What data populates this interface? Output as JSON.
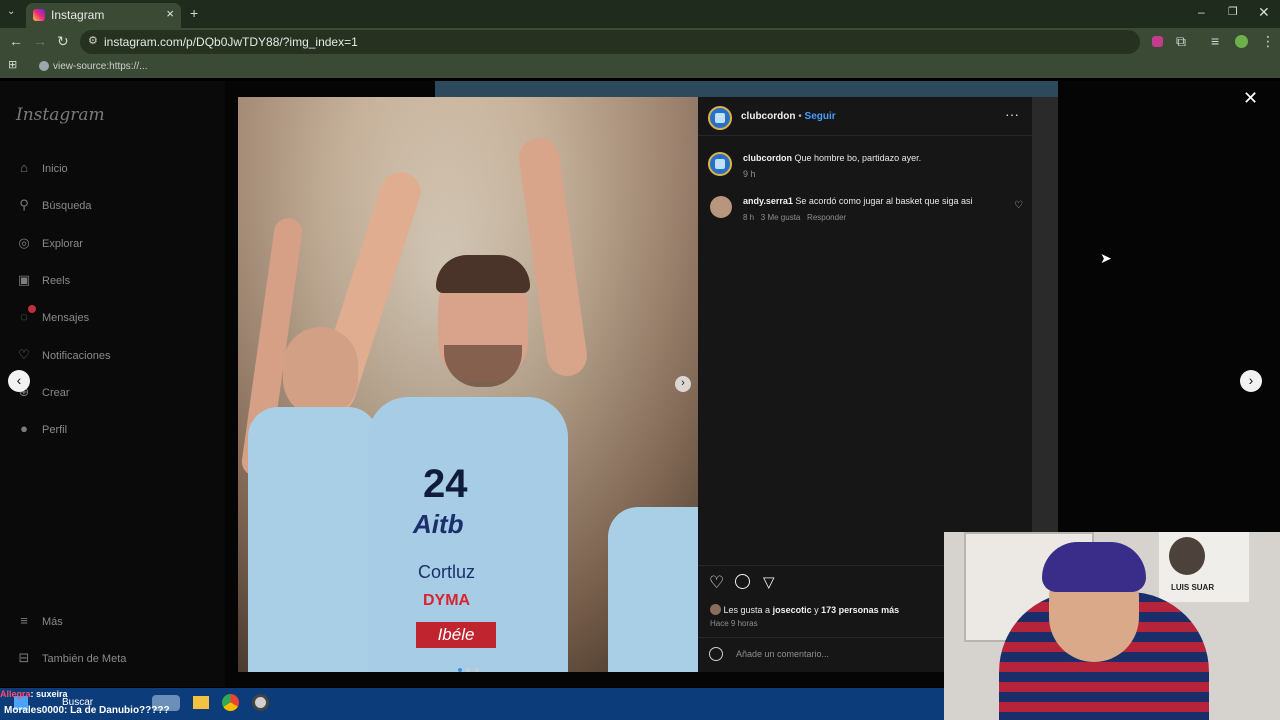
{
  "browser": {
    "tab_title": "Instagram",
    "url": "instagram.com/p/DQb0JwTDY88/?img_index=1",
    "bookmark": "view-source:https://..."
  },
  "instagram": {
    "logo": "Instagram",
    "nav": [
      {
        "label": "Inicio",
        "icon": "home-icon"
      },
      {
        "label": "Búsqueda",
        "icon": "search-icon"
      },
      {
        "label": "Explorar",
        "icon": "compass-icon"
      },
      {
        "label": "Reels",
        "icon": "reels-icon"
      },
      {
        "label": "Mensajes",
        "icon": "messenger-icon"
      },
      {
        "label": "Notificaciones",
        "icon": "heart-icon"
      },
      {
        "label": "Crear",
        "icon": "plus-icon"
      },
      {
        "label": "Perfil",
        "icon": "profile-avatar"
      }
    ],
    "more": "Más",
    "meta": "También de Meta"
  },
  "post": {
    "author": "clubcordon",
    "follow": "Seguir",
    "separator": "•",
    "caption_author": "clubcordon",
    "caption": "Que hombre bo, partidazo ayer.",
    "caption_time": "9 h",
    "comment": {
      "author": "andy.serra1",
      "text": "Se acordó como jugar al basket que siga asi",
      "time": "8 h",
      "likes": "3 Me gusta",
      "reply": "Responder"
    },
    "likes_prefix": "Les gusta a",
    "likes_user": "josecotic",
    "likes_conj": "y",
    "likes_count": "173 personas más",
    "posted": "Hace 9 horas",
    "comment_placeholder": "Añade un comentario...",
    "jersey": {
      "number": "24",
      "sponsor1": "Aitb",
      "sponsor2": "Cortluz",
      "sponsor3": "DYMA",
      "sponsor4": "Ibéle"
    }
  },
  "stream": {
    "chat": [
      {
        "user": "Allegra",
        "text": ": suxeira"
      },
      {
        "user": "Morales0000",
        "text": ": La de Danubio?????"
      }
    ],
    "search": "Buscar",
    "poster_text": "LUIS SUAR"
  },
  "colors": {
    "follow": "#4a9eff",
    "chat_user1": "#ff4d6d",
    "chat_user2": "#ffffff",
    "taskbar": "#0c3d7a"
  }
}
